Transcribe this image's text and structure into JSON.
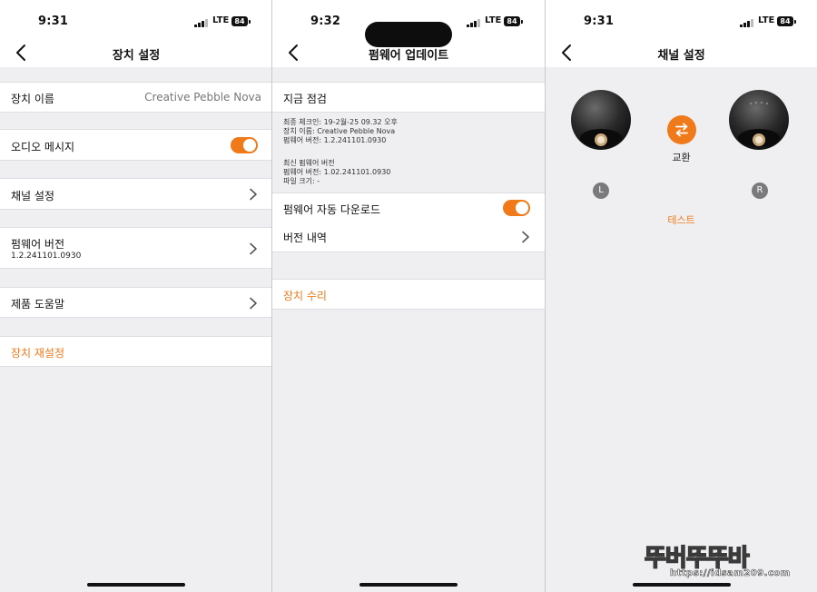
{
  "screens": [
    {
      "status": {
        "time": "9:31",
        "network": "LTE",
        "battery": "84"
      },
      "nav": {
        "title": "장치 설정"
      },
      "device_name": {
        "label": "장치 이름",
        "value": "Creative Pebble Nova"
      },
      "audio_message": {
        "label": "오디오 메시지",
        "enabled": true
      },
      "channel_settings": {
        "label": "채널 설정"
      },
      "firmware": {
        "label": "펌웨어 버전",
        "version": "1.2.241101.0930"
      },
      "product_help": {
        "label": "제품 도움말"
      },
      "reset": {
        "label": "장치 재설정"
      }
    },
    {
      "status": {
        "time": "9:32",
        "network": "LTE",
        "battery": "84"
      },
      "nav": {
        "title": "펌웨어 업데이트"
      },
      "check_now": {
        "label": "지금 점검"
      },
      "current_info": [
        "최종 체크인: 19-2월-25 09.32 오후",
        "장치 이름: Creative Pebble Nova",
        "펌웨어 버전: 1.2.241101.0930"
      ],
      "latest_info": [
        "최신 펌웨어 버전",
        "펌웨어 버전: 1.02.241101.0930",
        "파일 크기: -"
      ],
      "auto_download": {
        "label": "펌웨어 자동 다운로드",
        "enabled": true
      },
      "version_history": {
        "label": "버전 내역"
      },
      "repair": {
        "label": "장치 수리"
      }
    },
    {
      "status": {
        "time": "9:31",
        "network": "LTE",
        "battery": "84"
      },
      "nav": {
        "title": "채널 설정"
      },
      "swap": {
        "label": "교환"
      },
      "left_badge": "L",
      "right_badge": "R",
      "test": {
        "label": "테스트"
      }
    }
  ],
  "icons": {
    "back": "chevron-left-icon",
    "disclosure": "chevron-right-icon",
    "swap": "swap-arrows-icon",
    "speaker": "speaker-icon"
  },
  "watermark": {
    "title": "뚜버뚜뚜바",
    "url": "https://idsam209.com"
  },
  "colors": {
    "accent": "#f07a1a",
    "background": "#efeff2",
    "row": "#ffffff",
    "badge": "#7a7a7d"
  }
}
